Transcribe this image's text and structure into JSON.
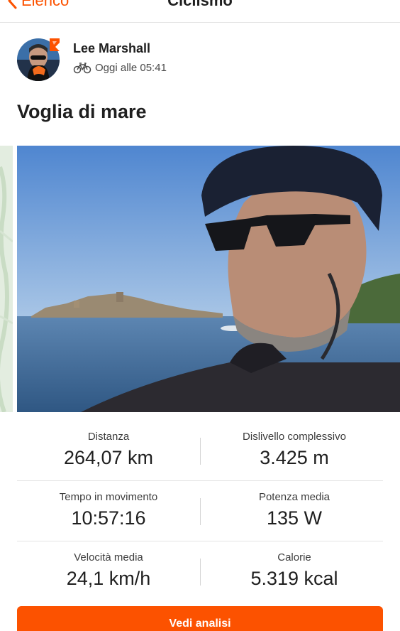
{
  "nav": {
    "back_label": "Elenco",
    "title": "Ciclismo"
  },
  "athlete": {
    "name": "Lee Marshall",
    "timestamp": "Oggi alle 05:41",
    "activity_icon": "bike-icon"
  },
  "activity": {
    "title": "Voglia di mare"
  },
  "stats": [
    {
      "label": "Distanza",
      "value": "264,07 km"
    },
    {
      "label": "Dislivello complessivo",
      "value": "3.425 m"
    },
    {
      "label": "Tempo in movimento",
      "value": "10:57:16"
    },
    {
      "label": "Potenza media",
      "value": "135 W"
    },
    {
      "label": "Velocità media",
      "value": "24,1 km/h"
    },
    {
      "label": "Calorie",
      "value": "5.319 kcal"
    }
  ],
  "cta": {
    "label": "Vedi analisi"
  },
  "colors": {
    "accent": "#fc5200",
    "text": "#1f1f1f"
  }
}
